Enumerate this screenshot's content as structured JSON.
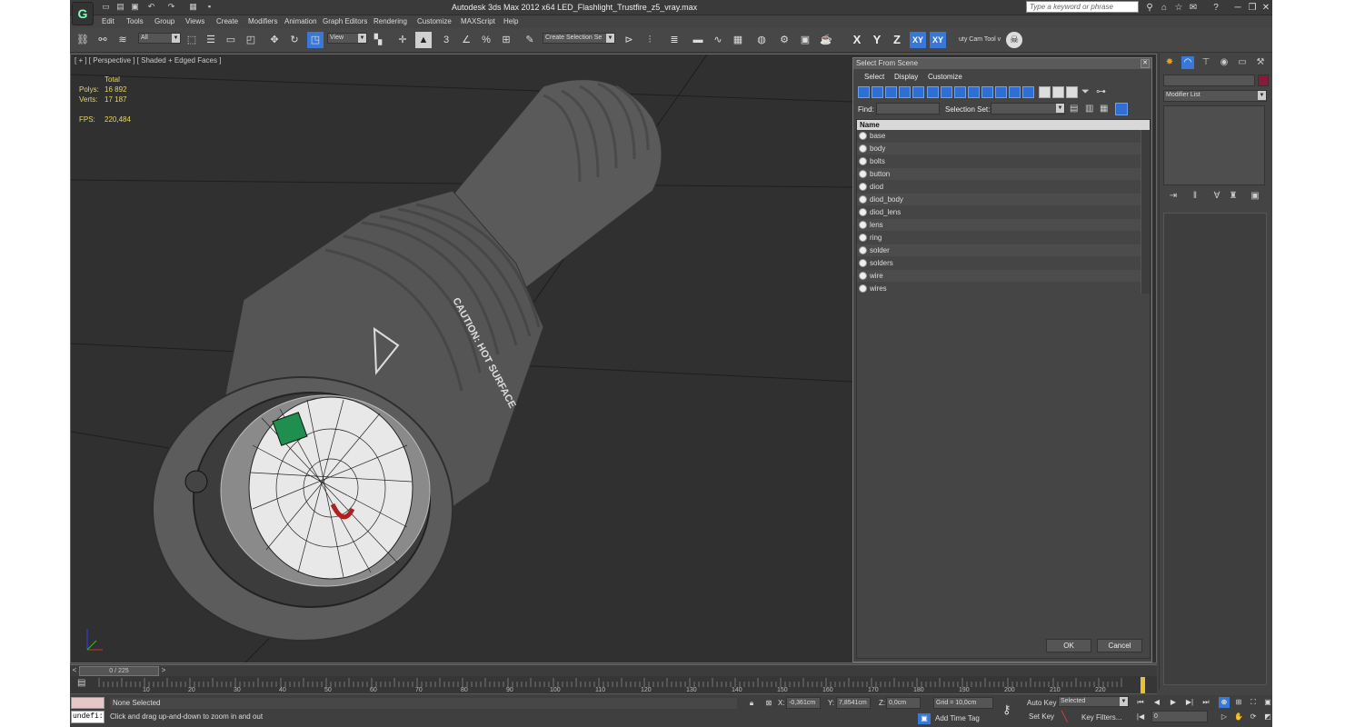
{
  "app": {
    "title": "Autodesk 3ds Max  2012 x64     LED_Flashlight_Trustfire_z5_vray.max",
    "logo_glyph": "G",
    "search_placeholder": "Type a keyword or phrase"
  },
  "menu": [
    "Edit",
    "Tools",
    "Group",
    "Views",
    "Create",
    "Modifiers",
    "Animation",
    "Graph Editors",
    "Rendering",
    "Customize",
    "MAXScript",
    "Help"
  ],
  "toolbar": {
    "filter_value": "All",
    "ref_coord_value": "View",
    "named_sel_value": "Create Selection Se",
    "plugin_label": "uty Cam Tool v",
    "axis_x": "X",
    "axis_y": "Y",
    "axis_z": "Z",
    "axis_xy": "XY",
    "axis_xy2": "XY",
    "snap_label": "3",
    "angle_label": "∠",
    "percent_label": "%"
  },
  "viewport": {
    "label": "[ + ] [ Perspective ] [ Shaded + Edged Faces ]",
    "stats": {
      "total_label": "Total",
      "polys_label": "Polys:",
      "polys_value": "16 892",
      "verts_label": "Verts:",
      "verts_value": "17 187",
      "fps_label": "FPS:",
      "fps_value": "220,484"
    },
    "decal_text": "CAUTION: HOT SURFACE"
  },
  "dialog": {
    "title": "Select From Scene",
    "menus": [
      "Select",
      "Display",
      "Customize"
    ],
    "find_label": "Find:",
    "selection_set_label": "Selection Set:",
    "column_name": "Name",
    "items": [
      "base",
      "body",
      "bolts",
      "button",
      "diod",
      "diod_body",
      "diod_lens",
      "lens",
      "ring",
      "solder",
      "solders",
      "wire",
      "wires"
    ],
    "ok": "OK",
    "cancel": "Cancel"
  },
  "command_panel": {
    "modifier_list": "Modifier List",
    "color": "#8a1a3a"
  },
  "timeline": {
    "frame": "0 / 225",
    "ticks": [
      "10",
      "20",
      "30",
      "40",
      "50",
      "60",
      "70",
      "80",
      "90",
      "100",
      "110",
      "120",
      "130",
      "140",
      "150",
      "160",
      "170",
      "180",
      "190",
      "200",
      "210",
      "220"
    ]
  },
  "status": {
    "maxscript": "undefi:",
    "selection": "None Selected",
    "prompt": "Click and drag up-and-down to zoom in and out",
    "x_label": "X:",
    "x_value": "-0,361cm",
    "y_label": "Y:",
    "y_value": "7,8541cm",
    "z_label": "Z:",
    "z_value": "0,0cm",
    "grid": "Grid = 10,0cm",
    "auto_key": "Auto Key",
    "set_key": "Set Key",
    "key_mode": "Selected",
    "key_filters": "Key Filters...",
    "add_time_tag": "Add Time Tag",
    "frame_field": "0"
  }
}
